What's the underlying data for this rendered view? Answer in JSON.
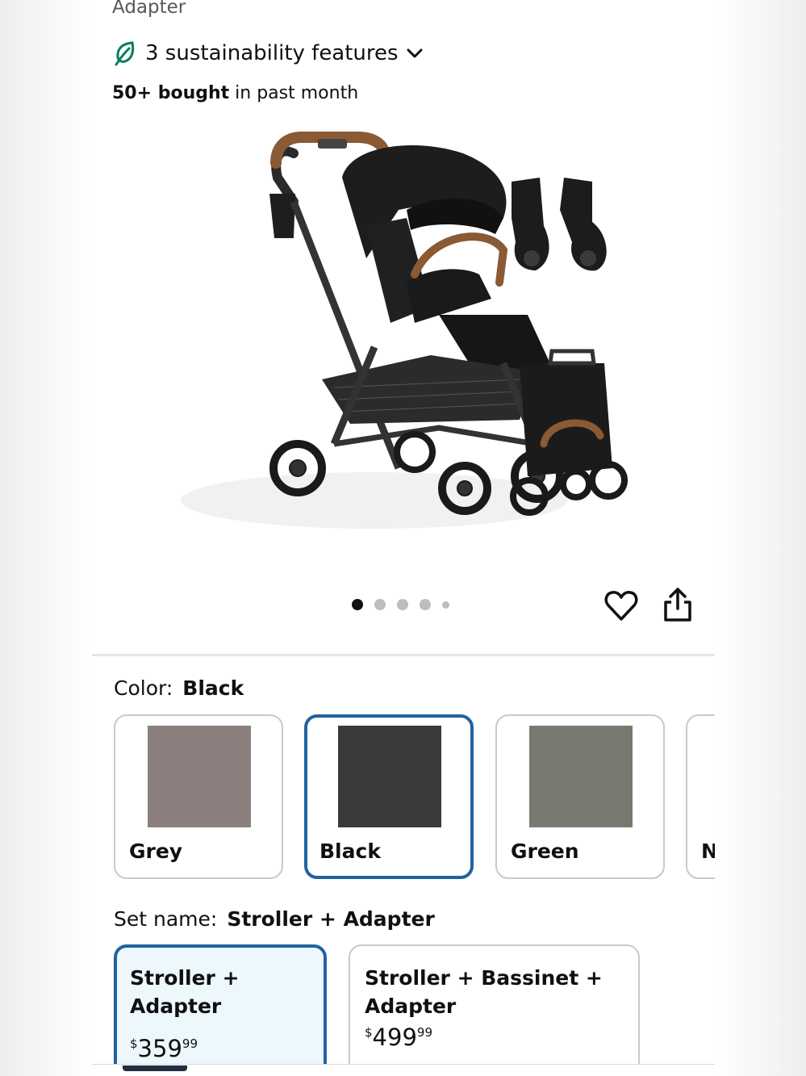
{
  "header": {
    "title_fragment": "Adapter",
    "sustainability_label": "3 sustainability features",
    "bought_bold": "50+ bought",
    "bought_rest": " in past month"
  },
  "gallery": {
    "image_alt": "Black stroller with adapters and folded view",
    "dot_count": 5,
    "active_dot": 1
  },
  "icons": {
    "sustainability": "leaf-icon",
    "expand": "chevron-down-icon",
    "favorite": "heart-icon",
    "share": "share-icon"
  },
  "color": {
    "label": "Color:",
    "selected": "Black",
    "options": [
      {
        "name": "Grey",
        "hex": "#8a7f7d"
      },
      {
        "name": "Black",
        "hex": "#3a3a3a"
      },
      {
        "name": "Green",
        "hex": "#767a70"
      },
      {
        "name": "N",
        "hex": "#ffffff"
      }
    ]
  },
  "set": {
    "label": "Set name:",
    "selected": "Stroller + Adapter",
    "options": [
      {
        "name": "Stroller + Adapter",
        "currency": "$",
        "whole": "359",
        "fraction": "99"
      },
      {
        "name": "Stroller + Bassinet + Adapter",
        "currency": "$",
        "whole": "499",
        "fraction": "99"
      }
    ]
  },
  "colors": {
    "selected_border": "#2162a1",
    "selected_bg": "#edf8fc",
    "leaf": "#067d62"
  }
}
